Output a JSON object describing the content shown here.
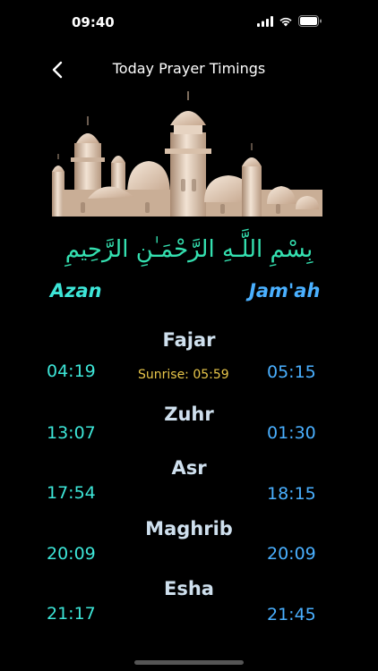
{
  "status": {
    "time": "09:40"
  },
  "nav": {
    "title": "Today Prayer Timings"
  },
  "header": {
    "bismillah": "بِسْمِ اللَّـهِ الرَّحْمَـٰنِ الرَّحِيمِ",
    "azan_label": "Azan",
    "jamah_label": "Jam'ah"
  },
  "prayers": [
    {
      "name": "Fajar",
      "azan": "04:19",
      "jamah": "05:15",
      "extra": "Sunrise: 05:59"
    },
    {
      "name": "Zuhr",
      "azan": "13:07",
      "jamah": "01:30"
    },
    {
      "name": "Asr",
      "azan": "17:54",
      "jamah": "18:15"
    },
    {
      "name": "Maghrib",
      "azan": "20:09",
      "jamah": "20:09"
    },
    {
      "name": "Esha",
      "azan": "21:17",
      "jamah": "21:45"
    }
  ],
  "colors": {
    "azan": "#3de6d8",
    "jamah": "#4ab0ff",
    "prayer_name": "#cfe0ee",
    "sunrise": "#e8c64a",
    "bismillah": "#34e0b0",
    "background": "#000000"
  },
  "icons": [
    "signal-icon",
    "wifi-icon",
    "battery-icon",
    "chevron-left-icon",
    "mosque-illustration"
  ]
}
